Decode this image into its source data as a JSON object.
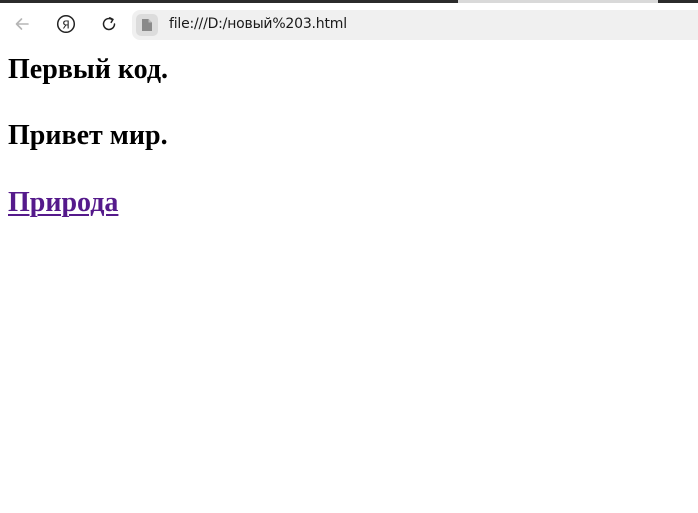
{
  "browser": {
    "address": "file:///D:/новый%203.html",
    "icons": {
      "back": "arrow-left-icon",
      "yandex": "yandex-logo-icon",
      "reload": "reload-icon",
      "file": "file-icon"
    }
  },
  "page": {
    "heading1": "Первый код.",
    "heading2": "Привет мир.",
    "link_text": "Природа",
    "link_color": "#551a8b"
  }
}
